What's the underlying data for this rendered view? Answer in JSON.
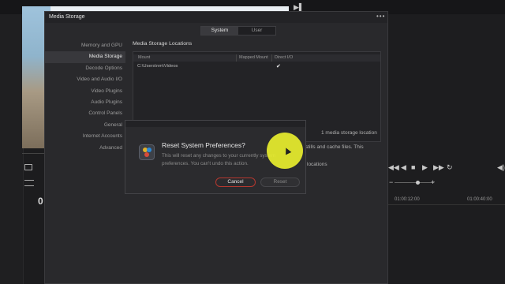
{
  "window": {
    "title": "Media Storage",
    "menu_glyph": "•••",
    "tabs": [
      {
        "label": "System",
        "active": true
      },
      {
        "label": "User",
        "active": false
      }
    ]
  },
  "sidebar": {
    "items": [
      {
        "label": "Memory and GPU"
      },
      {
        "label": "Media Storage",
        "active": true
      },
      {
        "label": "Decode Options"
      },
      {
        "label": "Video and Audio I/O"
      },
      {
        "label": "Video Plugins"
      },
      {
        "label": "Audio Plugins"
      },
      {
        "label": "Control Panels"
      },
      {
        "label": "General"
      },
      {
        "label": "Internet Accounts"
      },
      {
        "label": "Advanced"
      }
    ]
  },
  "storage": {
    "section_title": "Media Storage Locations",
    "columns": [
      "Mount",
      "Mapped Mount",
      "Direct I/O"
    ],
    "rows": [
      {
        "mount": "C:\\Users\\nm\\Videos",
        "mapped_mount": "",
        "direct_io_checked": true
      }
    ],
    "count_label": "1 media storage location",
    "partial_text_1": "stills and cache files. This",
    "partial_text_2": "locations"
  },
  "dialog": {
    "title": "Reset System Preferences?",
    "message": "This will reset any changes to your currently system preferences. You can't undo this action.",
    "cancel_label": "Cancel",
    "reset_label": "Reset",
    "icon": "davinci-resolve-logo-icon"
  },
  "background": {
    "timecode_1": "01:00:12:00",
    "timecode_2": "01:00:40:00",
    "counter": "0",
    "play_glyph": "▶▌"
  },
  "colors": {
    "accent_red": "#b6382f",
    "cursor_highlight": "#e8ee2e",
    "window_bg": "#29292c"
  }
}
